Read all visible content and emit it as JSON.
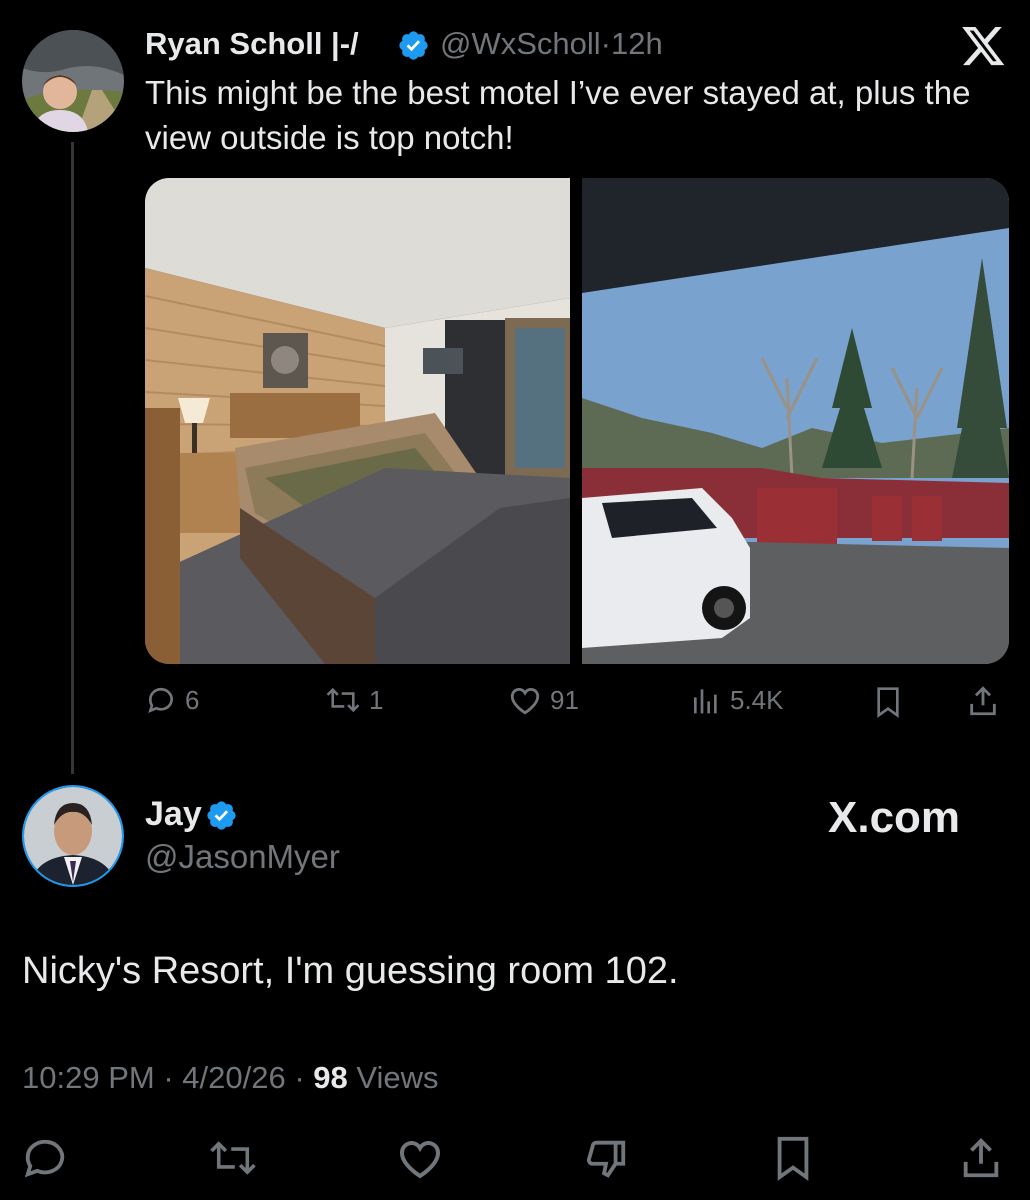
{
  "tweet": {
    "author_name": "Ryan Scholl |-/",
    "author_handle": "@WxScholl",
    "separator": "·",
    "time_ago": "12h",
    "text": "This might be the best motel I’ve ever stayed at, plus the view outside is top notch!",
    "stats": {
      "replies": "6",
      "reposts": "1",
      "likes": "91",
      "views": "5.4K"
    }
  },
  "reply": {
    "author_name": "Jay",
    "author_handle": "@JasonMyer",
    "text": "Nicky's Resort, I'm guessing room 102.",
    "time": "10:29 PM",
    "date": "4/20/26",
    "separator": "·",
    "views_count": "98",
    "views_label": "Views"
  },
  "watermark": "X.com",
  "colors": {
    "background": "#000000",
    "text": "#e7e9ea",
    "muted": "#71767b",
    "verified": "#1d9bf0",
    "thread_line": "#333639"
  },
  "icons": {
    "close": "x-logo-icon",
    "reply": "speech-bubble-icon",
    "repost": "repost-arrows-icon",
    "like": "heart-icon",
    "views": "bar-chart-icon",
    "bookmark": "bookmark-icon",
    "share": "share-up-arrow-icon",
    "dislike": "thumbs-down-icon",
    "verified": "verified-badge-icon"
  }
}
